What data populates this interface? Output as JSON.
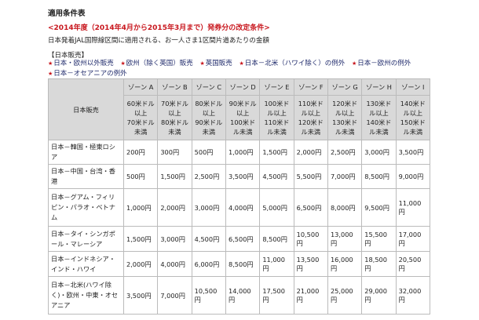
{
  "title": "適用条件表",
  "notice": "<2014年度（2014年4月から2015年3月まで）発券分の改定条件>",
  "description": "日本発着JAL国際線区間に適用される、お一人さま1区間片道あたりの金額",
  "section_label": "【日本販売】",
  "links": [
    "日本・欧州以外販売",
    "欧州（除く英国）販売",
    "英国販売",
    "日本－北米（ハワイ除く）の例外",
    "日本－欧州の例外",
    "日本－オセアニアの例外"
  ],
  "colors": {
    "notice": "#c8161d",
    "link": "#1f2a6b",
    "header_bg": "#d9d9d9"
  },
  "table": {
    "corner_label": "日本販売",
    "zones": [
      "ゾーン A",
      "ゾーン B",
      "ゾーン C",
      "ゾーン D",
      "ゾーン E",
      "ゾーン F",
      "ゾーン G",
      "ゾーン H",
      "ゾーン I"
    ],
    "ranges": [
      "60米ドル\n以上\n70米ドル\n未満",
      "70米ドル\n以上\n80米ドル\n未満",
      "80米ドル\n以上\n90米ドル\n未満",
      "90米ドル\n以上\n100米ド\nル未満",
      "100米ド\nル以上\n110米ド\nル未満",
      "110米ド\nル以上\n120米ド\nル未満",
      "120米ド\nル以上\n130米ド\nル未満",
      "130米ド\nル以上\n140米ド\nル未満",
      "140米ド\nル以上\n150米ド\nル未満"
    ],
    "rows": [
      {
        "route": "日本－韓国・極東ロシア",
        "values": [
          "200円",
          "300円",
          "500円",
          "1,000円",
          "1,500円",
          "2,000円",
          "2,500円",
          "3,000円",
          "3,500円"
        ]
      },
      {
        "route": "日本－中国・台湾・香港",
        "values": [
          "500円",
          "1,500円",
          "2,500円",
          "3,500円",
          "4,500円",
          "5,500円",
          "7,000円",
          "8,500円",
          "9,000円"
        ]
      },
      {
        "route": "日本－グアム・フィリピン・パラオ・ベトナム",
        "values": [
          "1,000円",
          "2,000円",
          "3,000円",
          "4,000円",
          "5,000円",
          "6,500円",
          "8,000円",
          "9,500円",
          "11,000円"
        ]
      },
      {
        "route": "日本－タイ・シンガポール・マレーシア",
        "values": [
          "1,500円",
          "3,000円",
          "4,500円",
          "6,500円",
          "8,500円",
          "10,500円",
          "13,000円",
          "15,500円",
          "17,000円"
        ]
      },
      {
        "route": "日本－インドネシア・インド・ハワイ",
        "values": [
          "2,000円",
          "4,000円",
          "6,000円",
          "8,500円",
          "11,000円",
          "13,500円",
          "16,000円",
          "18,500円",
          "20,500円"
        ]
      },
      {
        "route": "日本－北米(ハワイ除く)・欧州・中東・オセアニア",
        "values": [
          "3,500円",
          "7,000円",
          "10,500円",
          "14,000円",
          "17,500円",
          "21,000円",
          "25,000円",
          "29,000円",
          "32,000円"
        ]
      }
    ]
  }
}
